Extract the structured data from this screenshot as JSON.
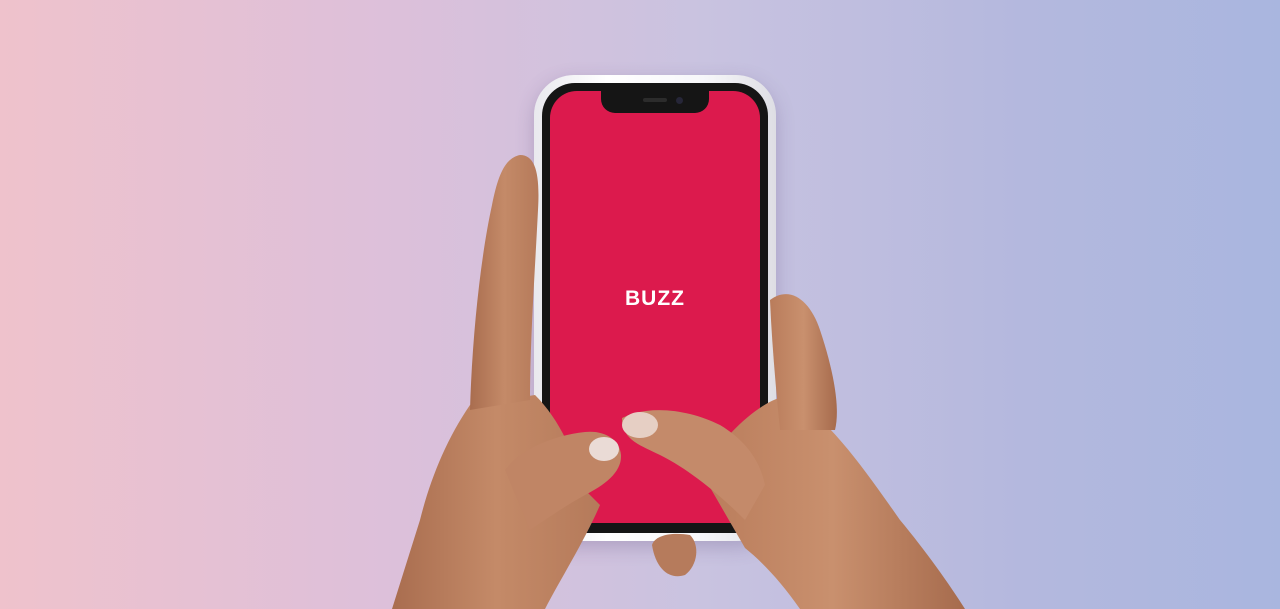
{
  "app": {
    "name": "BUZZ"
  },
  "colors": {
    "screen": "#dc1a4d",
    "background_left": "#efc2cc",
    "background_right": "#a9b6df",
    "phone_case": "#f7f7fa",
    "skin": "#c08565"
  },
  "icons": [
    "phone-notch",
    "front-camera"
  ]
}
